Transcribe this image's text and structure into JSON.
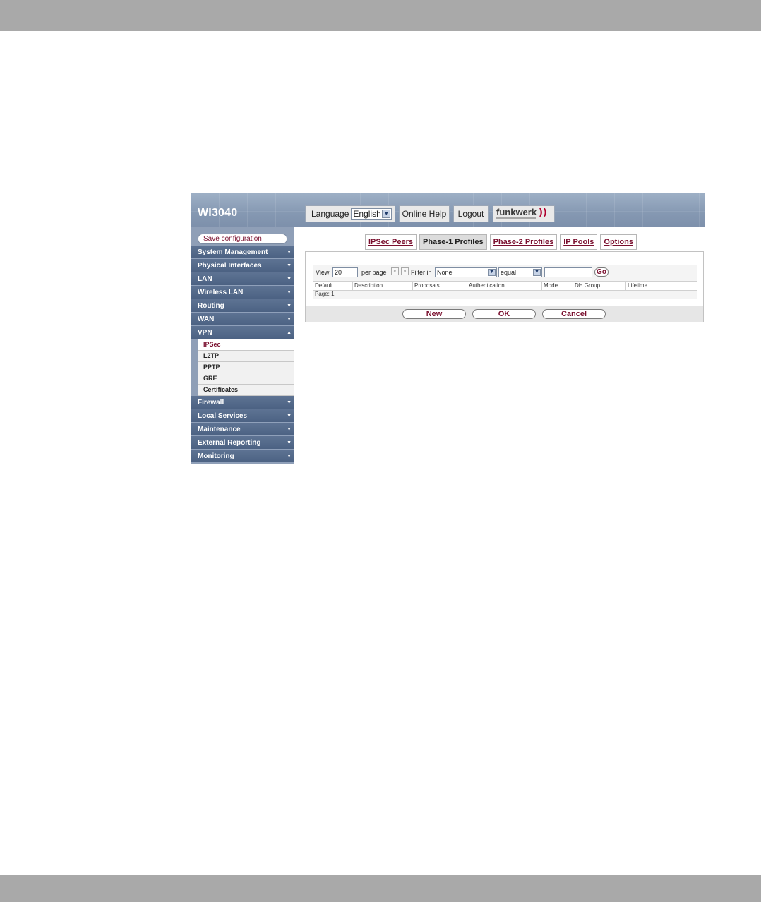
{
  "app": {
    "title": "WI3040",
    "language_label": "Language",
    "language_value": "English",
    "online_help": "Online Help",
    "logout": "Logout",
    "logo_text": "funkwerk",
    "logo_waves": "))"
  },
  "sidebar": {
    "save_configuration": "Save configuration",
    "items": [
      {
        "label": "System Management"
      },
      {
        "label": "Physical Interfaces"
      },
      {
        "label": "LAN"
      },
      {
        "label": "Wireless LAN"
      },
      {
        "label": "Routing"
      },
      {
        "label": "WAN"
      },
      {
        "label": "VPN"
      },
      {
        "label": "Firewall"
      },
      {
        "label": "Local Services"
      },
      {
        "label": "Maintenance"
      },
      {
        "label": "External Reporting"
      },
      {
        "label": "Monitoring"
      }
    ],
    "vpn_sub": [
      {
        "label": "IPSec"
      },
      {
        "label": "L2TP"
      },
      {
        "label": "PPTP"
      },
      {
        "label": "GRE"
      },
      {
        "label": "Certificates"
      }
    ]
  },
  "tabs": [
    {
      "label": "IPSec Peers"
    },
    {
      "label": "Phase-1 Profiles"
    },
    {
      "label": "Phase-2 Profiles"
    },
    {
      "label": "IP Pools"
    },
    {
      "label": "Options"
    }
  ],
  "filter": {
    "view_label": "View",
    "view_value": "20",
    "per_page": "per page",
    "prev_icon": "«",
    "next_icon": "»",
    "filter_in": "Filter in",
    "field_value": "None",
    "operator_value": "equal",
    "search_value": "",
    "go": "Go"
  },
  "table": {
    "columns": [
      "Default",
      "Description",
      "Proposals",
      "Authentication",
      "Mode",
      "DH Group",
      "Lifetime"
    ],
    "page_label": "Page: 1"
  },
  "buttons": {
    "new": "New",
    "ok": "OK",
    "cancel": "Cancel"
  }
}
